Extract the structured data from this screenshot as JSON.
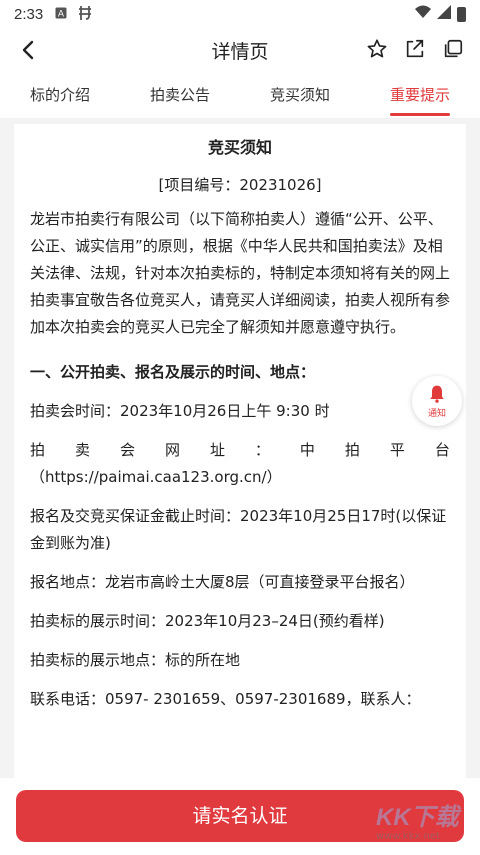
{
  "status_bar": {
    "time": "2:33",
    "icons": [
      "a-icon",
      "notification-app-icon"
    ],
    "right_icons": [
      "wifi-icon",
      "signal-icon",
      "battery-icon"
    ]
  },
  "nav": {
    "title": "详情页",
    "actions": [
      "star-icon",
      "share-icon",
      "copy-icon"
    ]
  },
  "tabs": [
    {
      "label": "标的介绍",
      "active": false
    },
    {
      "label": "拍卖公告",
      "active": false
    },
    {
      "label": "竞买须知",
      "active": false
    },
    {
      "label": "重要提示",
      "active": true
    }
  ],
  "doc": {
    "title": "竞买须知",
    "code": "[项目编号：20231026]",
    "intro": "龙岩市拍卖行有限公司（以下简称拍卖人）遵循“公开、公平、公正、诚实信用”的原则，根据《中华人民共和国拍卖法》及相关法律、法规，针对本次拍卖标的，特制定本须知将有关的网上拍卖事宜敬告各位竞买人，请竞买人详细阅读，拍卖人视所有参加本次拍卖会的竞买人已完全了解须知并愿意遵守执行。",
    "section1_title": "一、公开拍卖、报名及展示的时间、地点：",
    "auction_time": "拍卖会时间：2023年10月26日上午 9:30 时",
    "website_chars": [
      "拍",
      "卖",
      "会",
      "网",
      "址",
      "：",
      "中",
      "拍",
      "平",
      "台"
    ],
    "website_url": "（https://paimai.caa123.org.cn/）",
    "deposit_deadline": "报名及交竞买保证金截止时间：2023年10月25日17时(以保证金到账为准)",
    "signup_place": "报名地点：龙岩市高岭土大厦8层（可直接登录平台报名）",
    "display_time": "拍卖标的展示时间：2023年10月23–24日(预约看样)",
    "display_place": "拍卖标的展示地点：标的所在地",
    "contact": "联系电话：0597- 2301659、0597-2301689，联系人："
  },
  "notify": {
    "label": "通知",
    "color": "#e03a3a"
  },
  "bottom": {
    "verify_button": "请实名认证"
  },
  "watermark": {
    "text": "KK下载",
    "url": "www.kkx.net"
  },
  "colors": {
    "accent": "#e03a3a",
    "button": "#e0393e"
  }
}
